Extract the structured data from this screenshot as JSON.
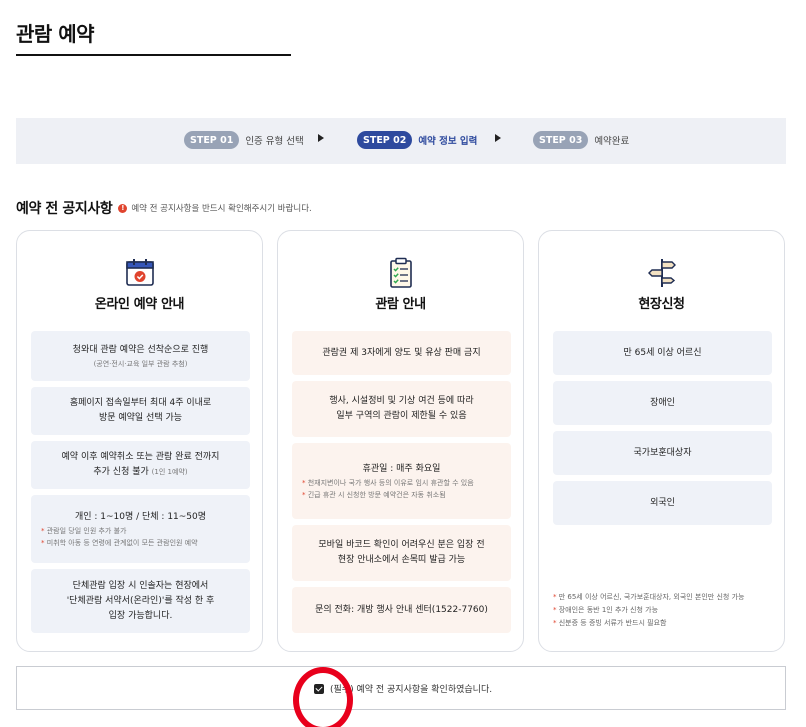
{
  "page": {
    "title": "관람 예약"
  },
  "steps": [
    {
      "badge": "STEP 01",
      "label": "인증 유형 선택",
      "active": false
    },
    {
      "badge": "STEP 02",
      "label": "예약 정보 입력",
      "active": true
    },
    {
      "badge": "STEP 03",
      "label": "예약완료",
      "active": false
    }
  ],
  "notice": {
    "title": "예약 전 공지사항",
    "alert_glyph": "!",
    "subtitle": "예약 전 공지사항을 반드시 확인해주시기 바랍니다."
  },
  "cards": {
    "online": {
      "title": "온라인 예약 안내",
      "icon": "calendar-check-icon",
      "box1_line": "청와대 관람 예약은 선착순으로 진행",
      "box1_small": "(공연·전시·교육 일부 관람 추첨)",
      "box2_line1": "홈페이지 접속일부터 최대 4주 이내로",
      "box2_line2": "방문 예약일 선택 가능",
      "box3_line1": "예약 이후 예약취소 또는 관람 완료 전까지",
      "box3_line2": "추가 신청 불가",
      "box3_suffix": "(1인 1예약)",
      "box4_line": "개인 : 1~10명 / 단체 : 11~50명",
      "box4_note1": "관람일 당일 인원 추가 불가",
      "box4_note2": "미취학 아동 등 연령에 관계없이 모든 관람인원 예약",
      "box5_line1": "단체관람 입장 시 인솔자는 현장에서",
      "box5_line2": "'단체관람 서약서(온라인)'를 작성 한 후",
      "box5_line3": "입장 가능합니다."
    },
    "viewing": {
      "title": "관람 안내",
      "icon": "clipboard-checklist-icon",
      "box1_line": "관람권 제 3자에게 양도 및 유상 판매 금지",
      "box2_line1": "행사, 시설정비 및 기상 여건 등에 따라",
      "box2_line2": "일부 구역의 관람이 제한될 수 있음",
      "box3_line": "휴관일 : 매주 화요일",
      "box3_note1": "천재지변이나 국가 행사 등의 이유로 임시 휴관할 수 있음",
      "box3_note2": "긴급 휴관 시 신청한 방문 예약건은 자동 취소됨",
      "box4_line1": "모바일 바코드 확인이 어려우신 분은 입장 전",
      "box4_line2": "현장 안내소에서 손목띠 발급 가능",
      "box5_line": "문의 전화: 개방 행사 안내 센터(1522-7760)"
    },
    "onsite": {
      "title": "현장신청",
      "icon": "signpost-icon",
      "items": [
        "만 65세 이상 어르신",
        "장애인",
        "국가보훈대상자",
        "외국인"
      ],
      "notes": [
        "만 65세 이상 어르신, 국가보훈대상자, 외국인 본인만 신청 가능",
        "장애인은 동반 1인 추가 신청 가능",
        "신분증 등 증빙 서류가 반드시 필요함"
      ]
    }
  },
  "agree": {
    "checked": true,
    "label": "(필수) 예약 전 공지사항을 확인하였습니다."
  },
  "colors": {
    "accent": "#2e4a9e",
    "step_inactive": "#98a3b6",
    "alert": "#e0442e",
    "annotation_circle": "#e8001c"
  }
}
